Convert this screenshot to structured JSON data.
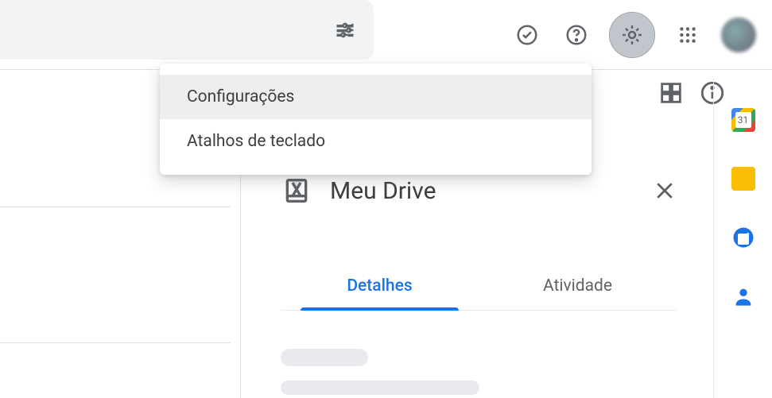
{
  "menu": {
    "items": [
      {
        "label": "Configurações",
        "hover": true
      },
      {
        "label": "Atalhos de teclado",
        "hover": false
      }
    ]
  },
  "panel": {
    "title": "Meu Drive",
    "tabs": [
      {
        "label": "Detalhes",
        "active": true
      },
      {
        "label": "Atividade",
        "active": false
      }
    ]
  },
  "sidepanel": {
    "apps": [
      {
        "name": "calendar"
      },
      {
        "name": "keep"
      },
      {
        "name": "tasks"
      },
      {
        "name": "contacts"
      }
    ]
  },
  "calendar_day": "31"
}
